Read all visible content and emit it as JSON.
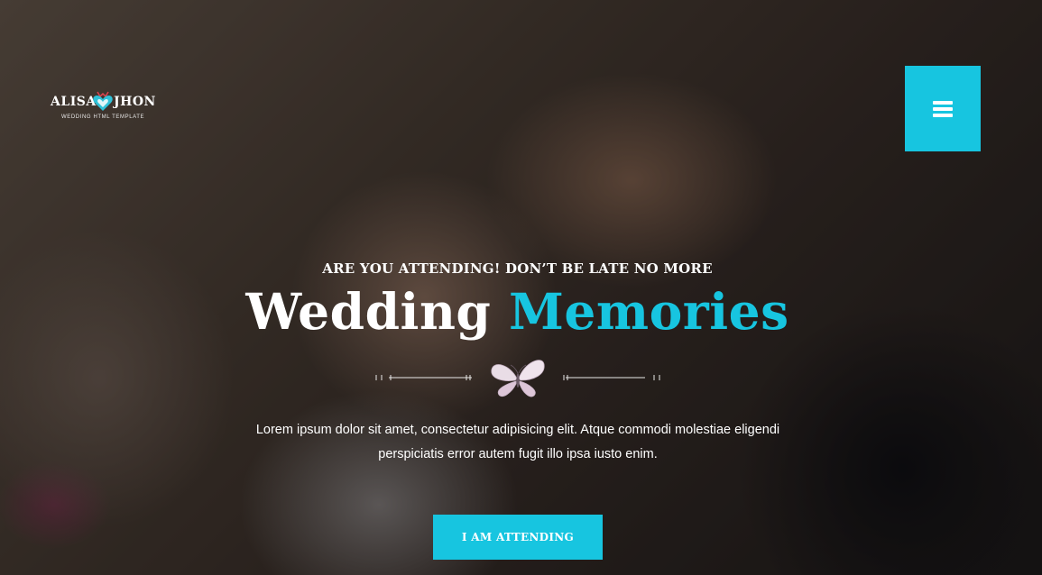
{
  "logo": {
    "name_left": "ALISA",
    "name_right": "JHON",
    "subtitle": "WEDDING HTML TEMPLATE"
  },
  "nav": {
    "menu_icon": "hamburger-menu-icon"
  },
  "hero": {
    "tagline": "ARE YOU ATTENDING! DON’T BE LATE NO MORE",
    "title_main": "Wedding",
    "title_accent": "Memories",
    "divider_icon": "butterfly-icon",
    "description": "Lorem ipsum dolor sit amet, consectetur adipisicing elit. Atque commodi molestiae eligendi perspiciatis error autem fugit illo ipsa iusto enim.",
    "cta_label": "I AM ATTENDING"
  },
  "colors": {
    "accent": "#17c5e0",
    "text": "#ffffff",
    "logo_heart": "#d9434f"
  }
}
